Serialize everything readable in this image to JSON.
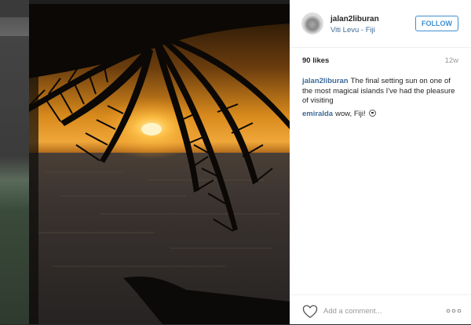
{
  "post": {
    "username": "jalan2liburan",
    "location": "Viti Levu - Fiji",
    "follow_label": "FOLLOW",
    "likes": "90 likes",
    "age": "12w",
    "comments": [
      {
        "user": "jalan2liburan",
        "text": "The final setting sun on one of the most magical islands I've had the pleasure of visiting"
      },
      {
        "user": "emiralda",
        "text": "wow, Fiji!"
      }
    ],
    "comment_placeholder": "Add a comment...",
    "icons": {
      "like": "heart-icon",
      "more": "more-options-icon",
      "emoji": "smiley-icon"
    },
    "colors": {
      "link": "#3d6a97",
      "follow": "#3f8fd2",
      "muted": "#999999"
    }
  }
}
